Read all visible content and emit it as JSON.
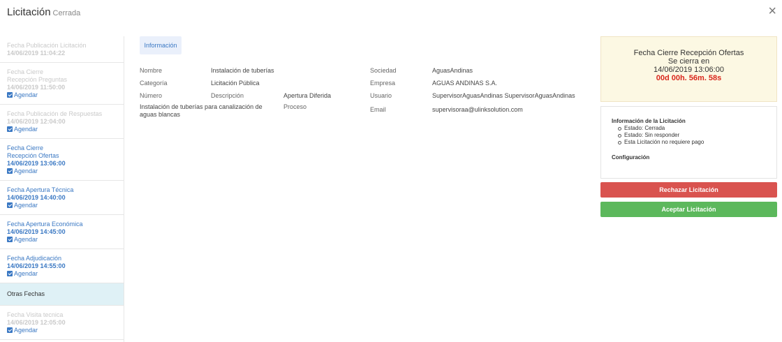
{
  "header": {
    "title": "Licitación",
    "status": "Cerrada",
    "close_icon": "close-icon"
  },
  "sidebar": {
    "items": [
      {
        "label": "Fecha Publicación Licitación",
        "date": "14/06/2019 11:04:22",
        "agendar": "",
        "state": "faded"
      },
      {
        "label": "Fecha Cierre\nRecepción Preguntas",
        "date": "14/06/2019 11:50:00",
        "agendar": "Agendar",
        "state": "faded"
      },
      {
        "label": "Fecha Publicación de Respuestas",
        "date": "14/06/2019 12:04:00",
        "agendar": "Agendar",
        "state": "faded"
      },
      {
        "label": "Fecha Cierre\nRecepción Ofertas",
        "date": "14/06/2019 13:06:00",
        "agendar": "Agendar",
        "state": "active"
      },
      {
        "label": "Fecha Apertura Técnica",
        "date": "14/06/2019 14:40:00",
        "agendar": "Agendar",
        "state": "active"
      },
      {
        "label": "Fecha Apertura Económica",
        "date": "14/06/2019 14:45:00",
        "agendar": "Agendar",
        "state": "active"
      },
      {
        "label": "Fecha Adjudicación",
        "date": "14/06/2019 14:55:00",
        "agendar": "Agendar",
        "state": "active"
      },
      {
        "label": "Otras Fechas",
        "date": "",
        "agendar": "",
        "state": "section"
      },
      {
        "label": "Fecha Visita tecnica",
        "date": "14/06/2019 12:05:00",
        "agendar": "Agendar",
        "state": "faded"
      }
    ]
  },
  "tab": {
    "label": "Información"
  },
  "info": {
    "nombre_label": "Nombre",
    "nombre_value": "Instalación de tuberías",
    "categoria_label": "Categoría",
    "categoria_value": "Licitación Pública",
    "numero_label": "Número",
    "descripcion_label": "Descripción",
    "apertura_label": "Apertura Diferida",
    "descripcion_value": "Instalación de tuberías para canalización de aguas blancas",
    "proceso_label": "Proceso",
    "sociedad_label": "Sociedad",
    "sociedad_value": "AguasAndinas",
    "empresa_label": "Empresa",
    "empresa_value": "AGUAS ANDINAS S.A.",
    "usuario_label": "Usuario",
    "usuario_value": "SupervisorAguasAndinas SupervisorAguasAndinas",
    "email_label": "Email",
    "email_value": "supervisoraa@ulinksolution.com"
  },
  "cierre": {
    "title": "Fecha Cierre Recepción Ofertas",
    "subtitle": "Se cierra en",
    "date": "14/06/2019 13:06:00",
    "countdown": "00d 00h. 56m. 58s"
  },
  "licitacion_info": {
    "title": "Información de la Licitación",
    "items": [
      "Estado: Cerrada",
      "Estado: Sin responder",
      "Esta Licitación no requiere pago"
    ],
    "config": "Configuración"
  },
  "buttons": {
    "reject": "Rechazar Licitación",
    "accept": "Aceptar Licitación"
  },
  "colors": {
    "accent": "#3a78c3",
    "danger": "#d9534f",
    "success": "#5cb85c",
    "countdown": "#d9261c",
    "warning_bg": "#fcf8e3"
  }
}
